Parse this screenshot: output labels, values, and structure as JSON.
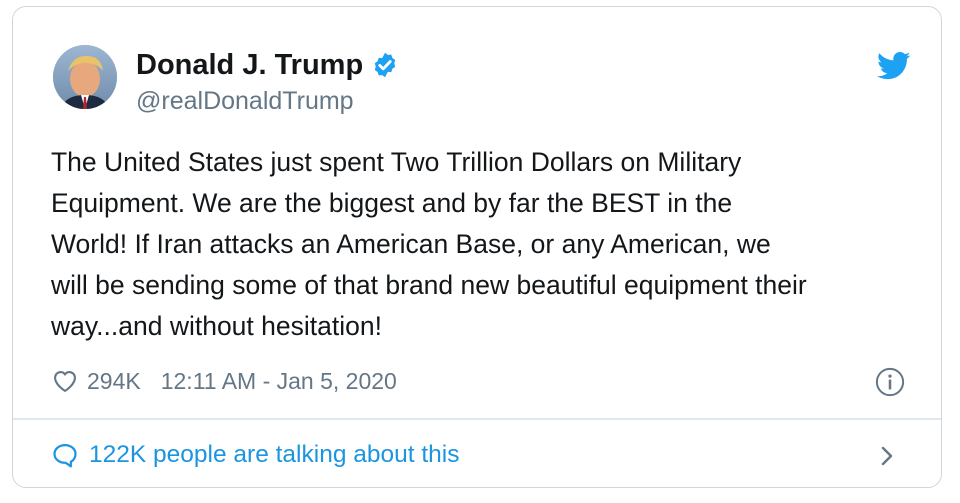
{
  "tweet": {
    "display_name": "Donald J. Trump",
    "handle": "@realDonaldTrump",
    "text": "The United States just spent Two Trillion Dollars on Military\nEquipment. We are the biggest and by far the BEST in the\nWorld! If Iran attacks an American Base, or any American, we\nwill be sending some of that brand new beautiful equipment their\nway...and without hesitation!",
    "likes": "294K",
    "timestamp": "12:11 AM - Jan 5, 2020",
    "conversation": "122K people are talking about this"
  },
  "icons": {
    "verified": "verified-badge-icon",
    "brand": "twitter-bird-icon",
    "like": "heart-icon",
    "info": "info-icon",
    "reply": "speech-bubble-icon",
    "more": "chevron-right-icon"
  },
  "colors": {
    "accent": "#1da1f2",
    "link": "#1b95e0",
    "text": "#14171a",
    "muted": "#657786",
    "border": "#cfd6db"
  }
}
